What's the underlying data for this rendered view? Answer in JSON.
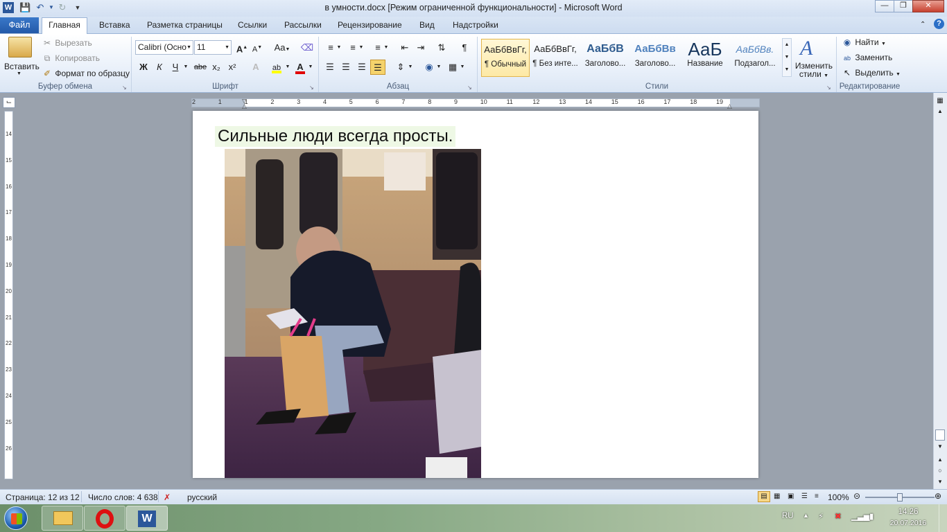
{
  "window": {
    "title": "в умности.docx [Режим ограниченной функциональности]  -  Microsoft Word"
  },
  "tabs": {
    "file": "Файл",
    "home": "Главная",
    "insert": "Вставка",
    "layout": "Разметка страницы",
    "references": "Ссылки",
    "mailings": "Рассылки",
    "review": "Рецензирование",
    "view": "Вид",
    "addins": "Надстройки"
  },
  "clipboard": {
    "paste": "Вставить",
    "cut": "Вырезать",
    "copy": "Копировать",
    "format_painter": "Формат по образцу",
    "group": "Буфер обмена"
  },
  "font": {
    "name": "Calibri (Осно",
    "size": "11",
    "group": "Шрифт",
    "bold": "Ж",
    "italic": "К",
    "underline": "Ч",
    "strike": "abe",
    "subscript": "x₂",
    "superscript": "x²",
    "case": "Aa",
    "grow": "A",
    "shrink": "A"
  },
  "paragraph": {
    "group": "Абзац"
  },
  "styles": {
    "group": "Стили",
    "items": [
      {
        "sample": "АаБбВвГг,",
        "name": "¶ Обычный"
      },
      {
        "sample": "АаБбВвГг,",
        "name": "¶ Без инте..."
      },
      {
        "sample": "АаБбВ",
        "name": "Заголово..."
      },
      {
        "sample": "АаБбВв",
        "name": "Заголово..."
      },
      {
        "sample": "АаБ",
        "name": "Название"
      },
      {
        "sample": "АаБбВв.",
        "name": "Подзагол..."
      }
    ],
    "change_line1": "Изменить",
    "change_line2": "стили"
  },
  "editing": {
    "group": "Редактирование",
    "find": "Найти",
    "replace": "Заменить",
    "select": "Выделить"
  },
  "ruler": {
    "top_ticks": [
      "2",
      "1",
      "1",
      "2",
      "3",
      "4",
      "5",
      "6",
      "7",
      "8",
      "9",
      "10",
      "11",
      "12",
      "13",
      "14",
      "15",
      "16",
      "17",
      "18",
      "19"
    ],
    "left_ticks": [
      "14",
      "15",
      "16",
      "17",
      "18",
      "19",
      "20",
      "21",
      "22",
      "23",
      "24",
      "25",
      "26"
    ]
  },
  "document": {
    "heading": "Сильные люди всегда просты."
  },
  "status": {
    "page": "Страница: 12 из 12",
    "words": "Число слов: 4 638",
    "language": "русский",
    "zoom": "100%",
    "zoom_level": 0.5
  },
  "taskbar": {
    "lang": "RU",
    "time": "14:26",
    "date": "20.07.2016"
  },
  "colors": {
    "accent": "#2b579a",
    "file_tab": "#2f6cbf",
    "highlight_yellow": "#ffff00",
    "font_red": "#e00000"
  }
}
